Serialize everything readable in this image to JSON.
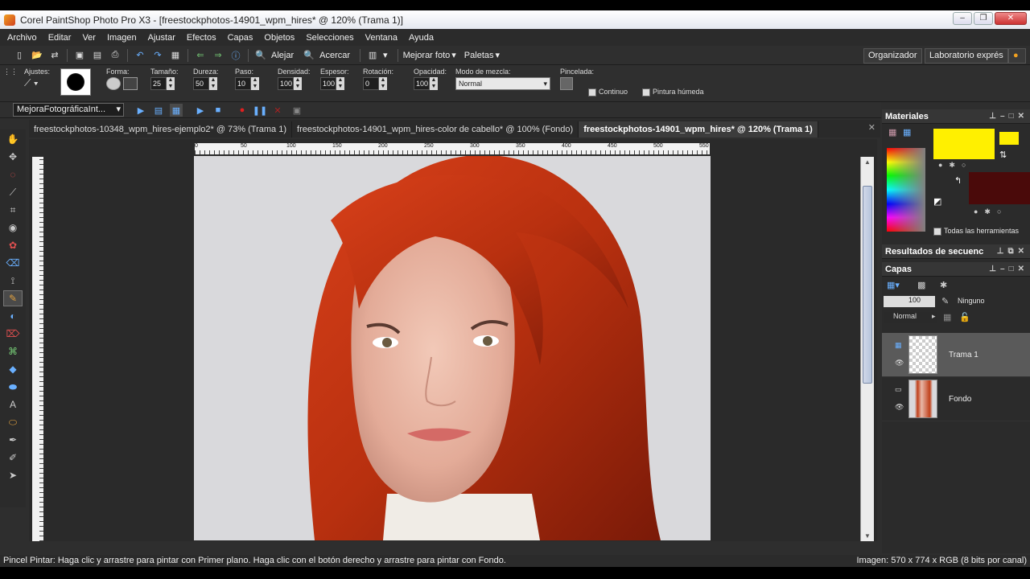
{
  "window": {
    "title": "Corel PaintShop Photo Pro X3 - [freestockphotos-14901_wpm_hires* @ 120% (Trama 1)]"
  },
  "menu": [
    "Archivo",
    "Editar",
    "Ver",
    "Imagen",
    "Ajustar",
    "Efectos",
    "Capas",
    "Objetos",
    "Selecciones",
    "Ventana",
    "Ayuda"
  ],
  "toolbar": {
    "zoom_out": "Alejar",
    "zoom_in": "Acercar",
    "enhance": "Mejorar foto",
    "palettes": "Paletas",
    "organizer": "Organizador",
    "express_lab": "Laboratorio exprés"
  },
  "tool_options": {
    "presets": "Ajustes:",
    "shape": "Forma:",
    "size": {
      "label": "Tamaño:",
      "value": "25"
    },
    "hardness": {
      "label": "Dureza:",
      "value": "50"
    },
    "step": {
      "label": "Paso:",
      "value": "10"
    },
    "density": {
      "label": "Densidad:",
      "value": "100"
    },
    "thickness": {
      "label": "Espesor:",
      "value": "100"
    },
    "rotation": {
      "label": "Rotación:",
      "value": "0"
    },
    "opacity": {
      "label": "Opacidad:",
      "value": "100"
    },
    "blend_mode": {
      "label": "Modo de mezcla:",
      "value": "Normal"
    },
    "brush_stroke": "Pincelada:",
    "continuous": "Continuo",
    "wet_paint": "Pintura húmeda"
  },
  "script": {
    "selected": "MejoraFotográficaInt..."
  },
  "tabs": [
    {
      "label": "freestockphotos-10348_wpm_hires-ejemplo2* @ 73% (Trama 1)"
    },
    {
      "label": "freestockphotos-14901_wpm_hires-color de cabello* @ 100% (Fondo)"
    },
    {
      "label": "freestockphotos-14901_wpm_hires* @ 120% (Trama 1)"
    }
  ],
  "ruler_labels": [
    "0",
    "50",
    "100",
    "150",
    "200",
    "250",
    "300",
    "350",
    "400",
    "450",
    "500",
    "550"
  ],
  "panels": {
    "materials": {
      "title": "Materiales",
      "all_tools": "Todas las herramientas",
      "fg_color": "#fff000",
      "bg_color": "#4a0a0a"
    },
    "sequence": {
      "title": "Resultados de secuenc"
    },
    "layers": {
      "title": "Capas",
      "opacity": "100",
      "none_label": "Ninguno",
      "blend": "Normal",
      "items": [
        {
          "name": "Trama 1"
        },
        {
          "name": "Fondo"
        }
      ]
    }
  },
  "status": {
    "left": "Pincel Pintar: Haga clic y arrastre para pintar con Primer plano. Haga clic con el botón derecho y arrastre para pintar con Fondo.",
    "right": "Imagen:  570 x 774 x RGB (8 bits por canal)"
  }
}
